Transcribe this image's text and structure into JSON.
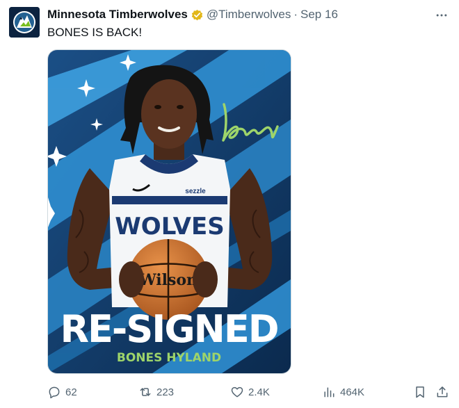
{
  "author": {
    "display_name": "Minnesota Timberwolves",
    "handle": "@Timberwolves",
    "separator": "·",
    "date": "Sep 16",
    "verified": true,
    "avatar_icon": "timberwolves-logo-icon"
  },
  "tweet": {
    "text": "BONES IS BACK!"
  },
  "media": {
    "headline": "RE-SIGNED",
    "player_name": "BONES HYLAND",
    "jersey_text": "WOLVES",
    "jersey_sponsor": "sezzle",
    "ball_brand": "Wilson",
    "signature_text": "Bones",
    "colors": {
      "bg_dark": "#0d2f57",
      "bg_light": "#3ea0df",
      "accent_green": "#9ed46a",
      "navy": "#0c2340"
    }
  },
  "actions": {
    "reply_count": "62",
    "retweet_count": "223",
    "like_count": "2.4K",
    "views_count": "464K"
  },
  "colors": {
    "secondary_text": "#536471",
    "verified_badge": "#e2b719"
  }
}
